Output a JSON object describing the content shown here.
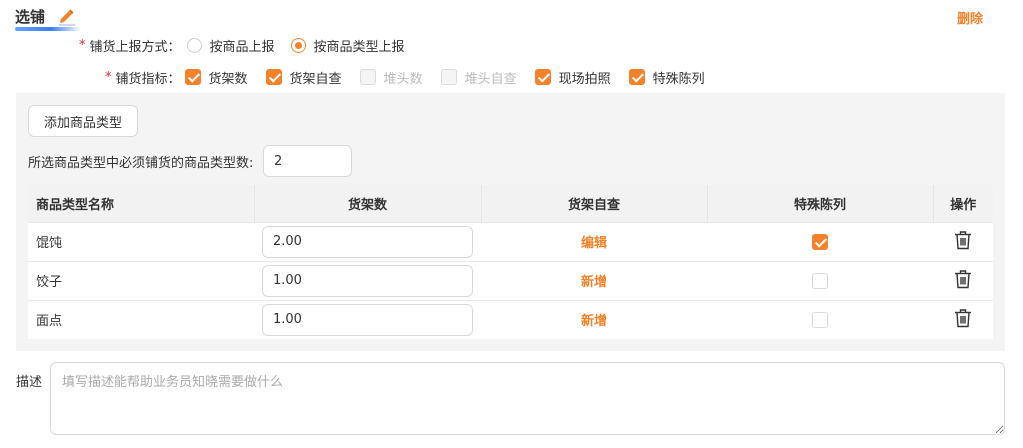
{
  "header": {
    "title": "选铺",
    "delete_label": "删除",
    "accent_color": "#f5822a"
  },
  "report_method": {
    "label": "铺货上报方式：",
    "required_mark": "*",
    "options": [
      {
        "label": "按商品上报",
        "checked": false
      },
      {
        "label": "按商品类型上报",
        "checked": true
      }
    ]
  },
  "indicators": {
    "label": "铺货指标：",
    "required_mark": "*",
    "items": [
      {
        "label": "货架数",
        "checked": true,
        "disabled": false
      },
      {
        "label": "货架自查",
        "checked": true,
        "disabled": false
      },
      {
        "label": "堆头数",
        "checked": false,
        "disabled": true
      },
      {
        "label": "堆头自查",
        "checked": false,
        "disabled": true
      },
      {
        "label": "现场拍照",
        "checked": true,
        "disabled": false
      },
      {
        "label": "特殊陈列",
        "checked": true,
        "disabled": false
      }
    ]
  },
  "panel": {
    "add_button_label": "添加商品类型",
    "required_count_label": "所选商品类型中必须铺货的商品类型数:",
    "required_count_value": "2"
  },
  "table": {
    "columns": [
      "商品类型名称",
      "货架数",
      "货架自查",
      "特殊陈列",
      "操作"
    ],
    "rows": [
      {
        "name": "馄饨",
        "shelf_count": "2.00",
        "self_check_action": "编辑",
        "special_display": true
      },
      {
        "name": "饺子",
        "shelf_count": "1.00",
        "self_check_action": "新增",
        "special_display": false
      },
      {
        "name": "面点",
        "shelf_count": "1.00",
        "self_check_action": "新增",
        "special_display": false
      }
    ]
  },
  "description": {
    "label": "描述",
    "placeholder": "填写描述能帮助业务员知晓需要做什么",
    "value": ""
  }
}
